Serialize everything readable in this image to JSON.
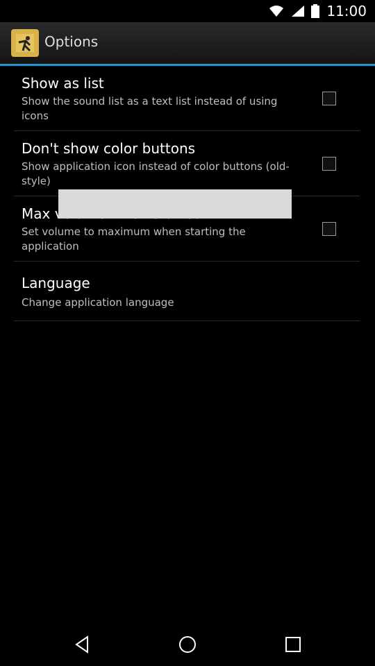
{
  "status": {
    "time": "11:00"
  },
  "header": {
    "title": "Options",
    "icon": "app-logo-icon"
  },
  "settings": [
    {
      "title": "Show as list",
      "summary": "Show the sound list as a text list instead of using icons",
      "checked": false
    },
    {
      "title": "Don't show color buttons",
      "summary": "Show application icon instead of color buttons (old-style)",
      "checked": false
    },
    {
      "title": "Max volume when started",
      "summary": "Set volume to maximum when starting the application",
      "checked": false
    },
    {
      "title": "Language",
      "summary": "Change application language"
    }
  ],
  "navbar": {
    "back": "back-icon",
    "home": "home-icon",
    "recents": "recents-icon"
  }
}
